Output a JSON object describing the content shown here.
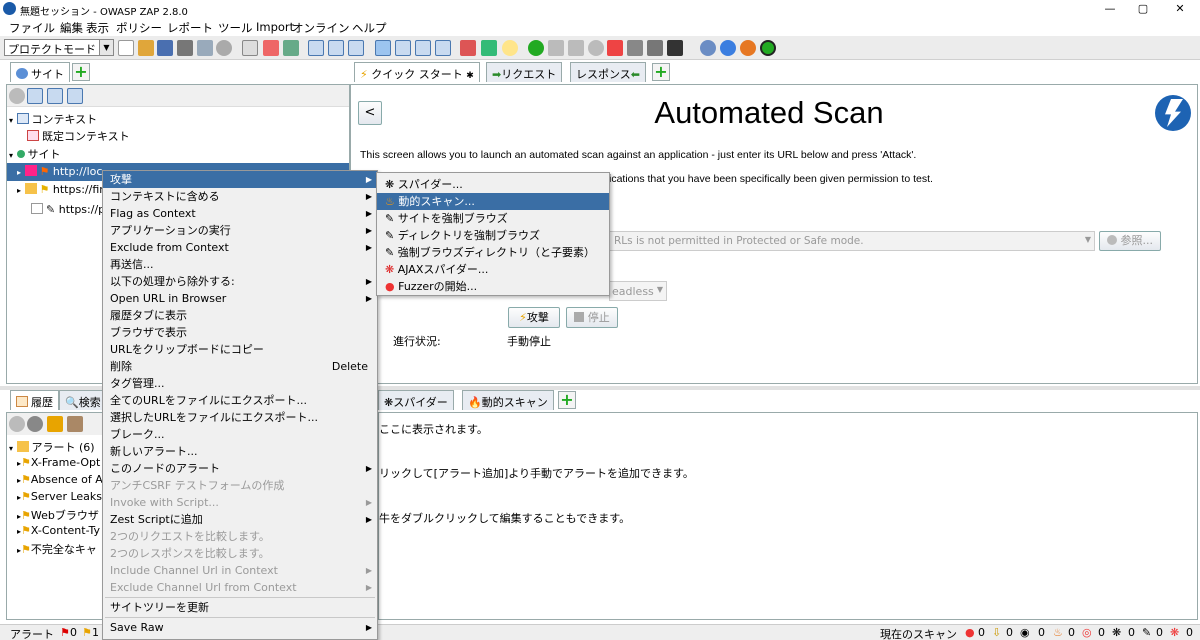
{
  "window": {
    "title": "無題セッション - OWASP ZAP 2.8.0",
    "minimize": "—",
    "maximize": "▢",
    "close": "✕"
  },
  "menu": [
    "ファイル",
    "編集",
    "表示",
    "ポリシー",
    "レポート",
    "ツール",
    "Import",
    "オンライン",
    "ヘルプ"
  ],
  "toolbar": {
    "mode": "プロテクトモード"
  },
  "left_tabs": {
    "sites": "サイト"
  },
  "tree": {
    "contexts": "コンテキスト",
    "default_context": "既定コンテキスト",
    "sites": "サイト",
    "site1": "http://loc",
    "site2": "https://fir",
    "site3": "https://p"
  },
  "right_tabs": {
    "quick_start": "クイック スタート",
    "request": "リクエスト",
    "response": "レスポンス"
  },
  "quick_start": {
    "back": "<",
    "heading": "Automated Scan",
    "intro": "This screen allows you to launch an automated scan against  an application - just enter its URL below and press 'Attack'.",
    "warning_tail": "ications that you have been specifically been given permission to test.",
    "url_placeholder": "RLs is not permitted in Protected or Safe mode.",
    "browse": "参照...",
    "headless_tail": "eadless",
    "attack": "攻撃",
    "stop": "停止",
    "progress_label": "進行状況:",
    "progress_value": "手動停止"
  },
  "bottom_left_tabs": {
    "history": "履歴",
    "search": "検索"
  },
  "bottom_right_tabs": {
    "spider": "スパイダー",
    "active_scan": "動的スキャン"
  },
  "alerts": {
    "root": "アラート (6)",
    "items": [
      "X-Frame-Opt",
      "Absence of A",
      "Server Leaks",
      "Webブラウザ",
      "X-Content-Ty",
      "不完全なキャ"
    ]
  },
  "alert_detail": {
    "line1": "ここに表示されます。",
    "line2": "リックして[アラート追加]より手動でアラートを追加できます。",
    "line3": "牛をダブルクリックして編集することもできます。"
  },
  "context_menu": [
    {
      "label": "攻撃",
      "arrow": true,
      "hl": true
    },
    {
      "label": "コンテキストに含める",
      "arrow": true
    },
    {
      "label": "Flag as Context",
      "arrow": true
    },
    {
      "label": "アプリケーションの実行",
      "arrow": true
    },
    {
      "label": "Exclude from Context",
      "arrow": true
    },
    {
      "label": "再送信..."
    },
    {
      "label": "以下の処理から除外する:",
      "arrow": true
    },
    {
      "label": "Open URL in Browser",
      "arrow": true
    },
    {
      "label": "履歴タブに表示"
    },
    {
      "label": "ブラウザで表示"
    },
    {
      "label": "URLをクリップボードにコピー"
    },
    {
      "label": "削除",
      "shortcut": "Delete"
    },
    {
      "label": "タグ管理..."
    },
    {
      "label": "全てのURLをファイルにエクスポート..."
    },
    {
      "label": "選択したURLをファイルにエクスポート..."
    },
    {
      "label": "ブレーク..."
    },
    {
      "label": "新しいアラート..."
    },
    {
      "label": "このノードのアラート",
      "arrow": true
    },
    {
      "label": "アンチCSRF テストフォームの作成",
      "dis": true
    },
    {
      "label": "Invoke with Script...",
      "dis": true,
      "arrow": true
    },
    {
      "label": "Zest Scriptに追加",
      "arrow": true
    },
    {
      "label": "2つのリクエストを比較します。",
      "dis": true
    },
    {
      "label": "2つのレスポンスを比較します。",
      "dis": true
    },
    {
      "label": "Include Channel Url in Context",
      "dis": true,
      "arrow": true
    },
    {
      "label": "Exclude Channel Url from Context",
      "dis": true,
      "arrow": true
    },
    {
      "label": "サイトツリーを更新",
      "sep": true
    },
    {
      "label": "Save Raw",
      "arrow": true,
      "sep": true
    }
  ],
  "attack_submenu": [
    {
      "label": "スパイダー..."
    },
    {
      "label": "動的スキャン...",
      "hl": true
    },
    {
      "label": "サイトを強制ブラウズ"
    },
    {
      "label": "ディレクトリを強制ブラウズ"
    },
    {
      "label": "強制ブラウズディレクトリ（と子要素）"
    },
    {
      "label": "AJAXスパイダー..."
    },
    {
      "label": "Fuzzerの開始..."
    }
  ],
  "status": {
    "alerts_label": "アラート",
    "alert_red": "0",
    "alert_orange": "1",
    "current_scans": "現在のスキャン",
    "counts": [
      "0",
      "0",
      "0",
      "0",
      "0",
      "0",
      "0",
      "0"
    ]
  }
}
